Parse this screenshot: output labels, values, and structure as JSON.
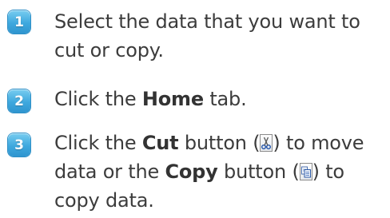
{
  "steps": [
    {
      "number": "1",
      "text": "Select the data that you want to cut or copy."
    },
    {
      "number": "2",
      "before": "Click the ",
      "bold": "Home",
      "after": " tab."
    },
    {
      "number": "3",
      "part1": "Click the ",
      "bold1": "Cut",
      "part2": " button (",
      "cut_icon": "scissors-icon",
      "part3": ") to move data or the ",
      "bold2": "Copy",
      "part4": " button (",
      "copy_icon": "copy-icon",
      "part5": ") to copy data."
    }
  ],
  "colors": {
    "badge": "#3fa8de",
    "text": "#3c3c3c"
  }
}
